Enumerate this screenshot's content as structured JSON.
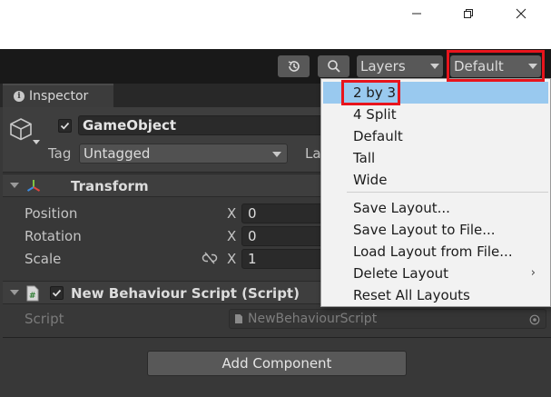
{
  "toolbar": {
    "layers_label": "Layers",
    "layout_label": "Default"
  },
  "inspector": {
    "tab_label": "Inspector",
    "gameobject": {
      "name": "GameObject",
      "active": true,
      "tag_label": "Tag",
      "tag_value": "Untagged",
      "layer_label": "La"
    }
  },
  "transform": {
    "title": "Transform",
    "properties": [
      {
        "label": "Position",
        "axis": "X",
        "value": "0"
      },
      {
        "label": "Rotation",
        "axis": "X",
        "value": "0"
      },
      {
        "label": "Scale",
        "axis": "X",
        "value": "1"
      }
    ]
  },
  "script_component": {
    "title": "New Behaviour Script (Script)",
    "enabled": true,
    "script_label": "Script",
    "script_value": "NewBehaviourScript"
  },
  "add_component_label": "Add Component",
  "layout_menu": {
    "items": [
      {
        "label": "2 by 3",
        "selected": true
      },
      {
        "label": "4 Split"
      },
      {
        "label": "Default"
      },
      {
        "label": "Tall"
      },
      {
        "label": "Wide"
      }
    ],
    "actions": [
      {
        "label": "Save Layout..."
      },
      {
        "label": "Save Layout to File..."
      },
      {
        "label": "Load Layout from File..."
      },
      {
        "label": "Delete Layout",
        "has_submenu": true
      },
      {
        "label": "Reset All Layouts"
      }
    ]
  },
  "colors": {
    "highlight_box": "#e8141c",
    "menu_selected": "#99c9ef",
    "toolbar_bg": "#191919",
    "panel_bg": "#383838"
  }
}
